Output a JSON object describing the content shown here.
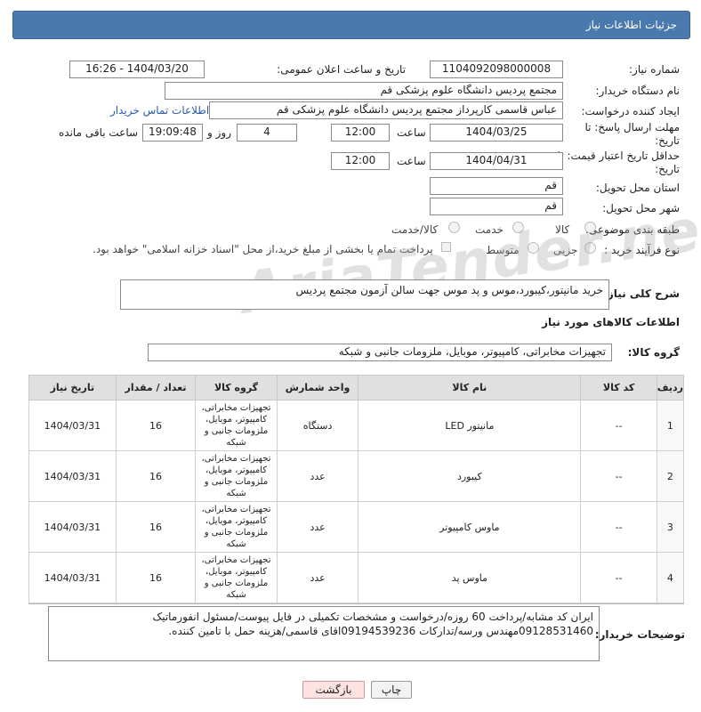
{
  "header": {
    "title": "جزئیات اطلاعات نیاز"
  },
  "form": {
    "need_number_label": "شماره نیاز:",
    "need_number": "1104092098000008",
    "announce_label": "تاریخ و ساعت اعلان عمومی:",
    "announce_value": "1404/03/20 - 16:26",
    "buyer_label": "نام دستگاه خریدار:",
    "buyer_value": "مجتمع پردیس دانشگاه علوم پزشکی قم",
    "creator_label": "ایجاد کننده درخواست:",
    "creator_value": "عباس قاسمی کارپرداز مجتمع پردیس دانشگاه علوم پزشکی قم",
    "contact_link": "اطلاعات تماس خریدار",
    "deadline_label": "مهلت ارسال پاسخ: تا تاریخ:",
    "deadline_date": "1404/03/25",
    "time_label": "ساعت",
    "deadline_time": "12:00",
    "days_value": "4",
    "days_label": "روز و",
    "remaining_time": "19:09:48",
    "remaining_label": "ساعت باقی مانده",
    "min_validity_label": "حداقل تاریخ اعتبار قیمت: تا تاریخ:",
    "validity_date": "1404/04/31",
    "validity_time": "12:00",
    "province_label": "استان محل تحویل:",
    "province_value": "قم",
    "city_label": "شهر محل تحویل:",
    "city_value": "قم",
    "category_label": "طبقه بندی موضوعی:",
    "category_options": [
      "کالا",
      "خدمت",
      "کالا/خدمت"
    ],
    "process_label": "نوع فرآیند خرید :",
    "process_options": [
      "جزیی",
      "متوسط"
    ],
    "payment_note": "پرداخت تمام یا بخشی از مبلغ خرید،از محل \"اسناد خزانه اسلامی\" خواهد بود.",
    "description_label": "شرح کلی نیاز:",
    "description_value": "خرید مانیتور،کیبورد،موس و پد موس جهت سالن آزمون مجتمع پردیس"
  },
  "goods_section": {
    "title": "اطلاعات کالاهای مورد نیاز",
    "group_label": "گروه کالا:",
    "group_value": "تجهیزات مخابراتی، کامپیوتر، موبایل، ملزومات جانبی و شبکه"
  },
  "table": {
    "headers": [
      "ردیف",
      "کد کالا",
      "نام کالا",
      "واحد شمارش",
      "گروه کالا",
      "تعداد / مقدار",
      "تاریخ نیاز"
    ],
    "rows": [
      {
        "num": "1",
        "code": "--",
        "name": "مانیتور LED",
        "unit": "دستگاه",
        "group": "تجهیزات مخابراتی، کامپیوتر، موبایل، ملزومات جانبی و شبکه",
        "qty": "16",
        "date": "1404/03/31"
      },
      {
        "num": "2",
        "code": "--",
        "name": "کیبورد",
        "unit": "عدد",
        "group": "تجهیزات مخابراتی، کامپیوتر، موبایل، ملزومات جانبی و شبکه",
        "qty": "16",
        "date": "1404/03/31"
      },
      {
        "num": "3",
        "code": "--",
        "name": "ماوس کامپیوتر",
        "unit": "عدد",
        "group": "تجهیزات مخابراتی، کامپیوتر، موبایل، ملزومات جانبی و شبکه",
        "qty": "16",
        "date": "1404/03/31"
      },
      {
        "num": "4",
        "code": "--",
        "name": "ماوس پد",
        "unit": "عدد",
        "group": "تجهیزات مخابراتی، کامپیوتر، موبایل، ملزومات جانبی و شبکه",
        "qty": "16",
        "date": "1404/03/31"
      }
    ]
  },
  "notes": {
    "label": "توضیحات خریدار:",
    "value": "ایران کد مشابه/پرداخت 60 روزه/درخواست و مشخصات تکمیلی در فایل پیوست/مسئول انفورماتیک 09128531460مهندس ورسه/تدارکات 09194539236اقای قاسمی/هزینه حمل با تامین کننده."
  },
  "buttons": {
    "print": "چاپ",
    "back": "بازگشت"
  },
  "watermark": "AriaTender.neT"
}
